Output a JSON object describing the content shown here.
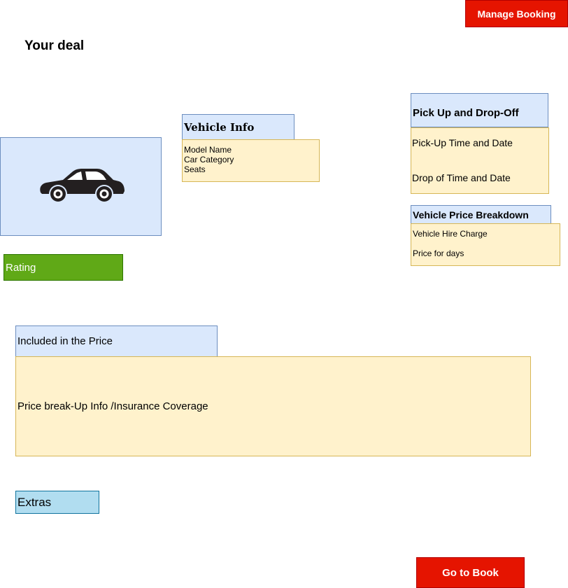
{
  "header": {
    "manage_booking_label": "Manage Booking",
    "title": "Your deal"
  },
  "car_image": {
    "icon": "car-icon",
    "icon_color": "#231f20"
  },
  "rating": {
    "label": "Rating"
  },
  "vehicle_info": {
    "heading": "Vehicle Info",
    "fields": [
      "Model Name",
      "Car Category",
      "Seats"
    ]
  },
  "pickup_dropoff": {
    "heading": "Pick Up and Drop-Off",
    "pickup_label": "Pick-Up Time and Date",
    "dropoff_label": "Drop of Time and Date"
  },
  "price_breakdown": {
    "heading": "Vehicle Price Breakdown",
    "hire_charge_label": "Vehicle Hire Charge",
    "price_days_label": "Price for days"
  },
  "included": {
    "heading": "Included in the Price",
    "body": "Price break-Up Info /Insurance Coverage"
  },
  "extras": {
    "label": "Extras"
  },
  "footer": {
    "book_label": "Go to Book"
  },
  "colors": {
    "primary_button": "#e51400",
    "info_header_fill": "#dae8fc",
    "info_body_fill": "#fff2cc",
    "rating_fill": "#60a917",
    "extras_fill": "#b1ddf0"
  }
}
